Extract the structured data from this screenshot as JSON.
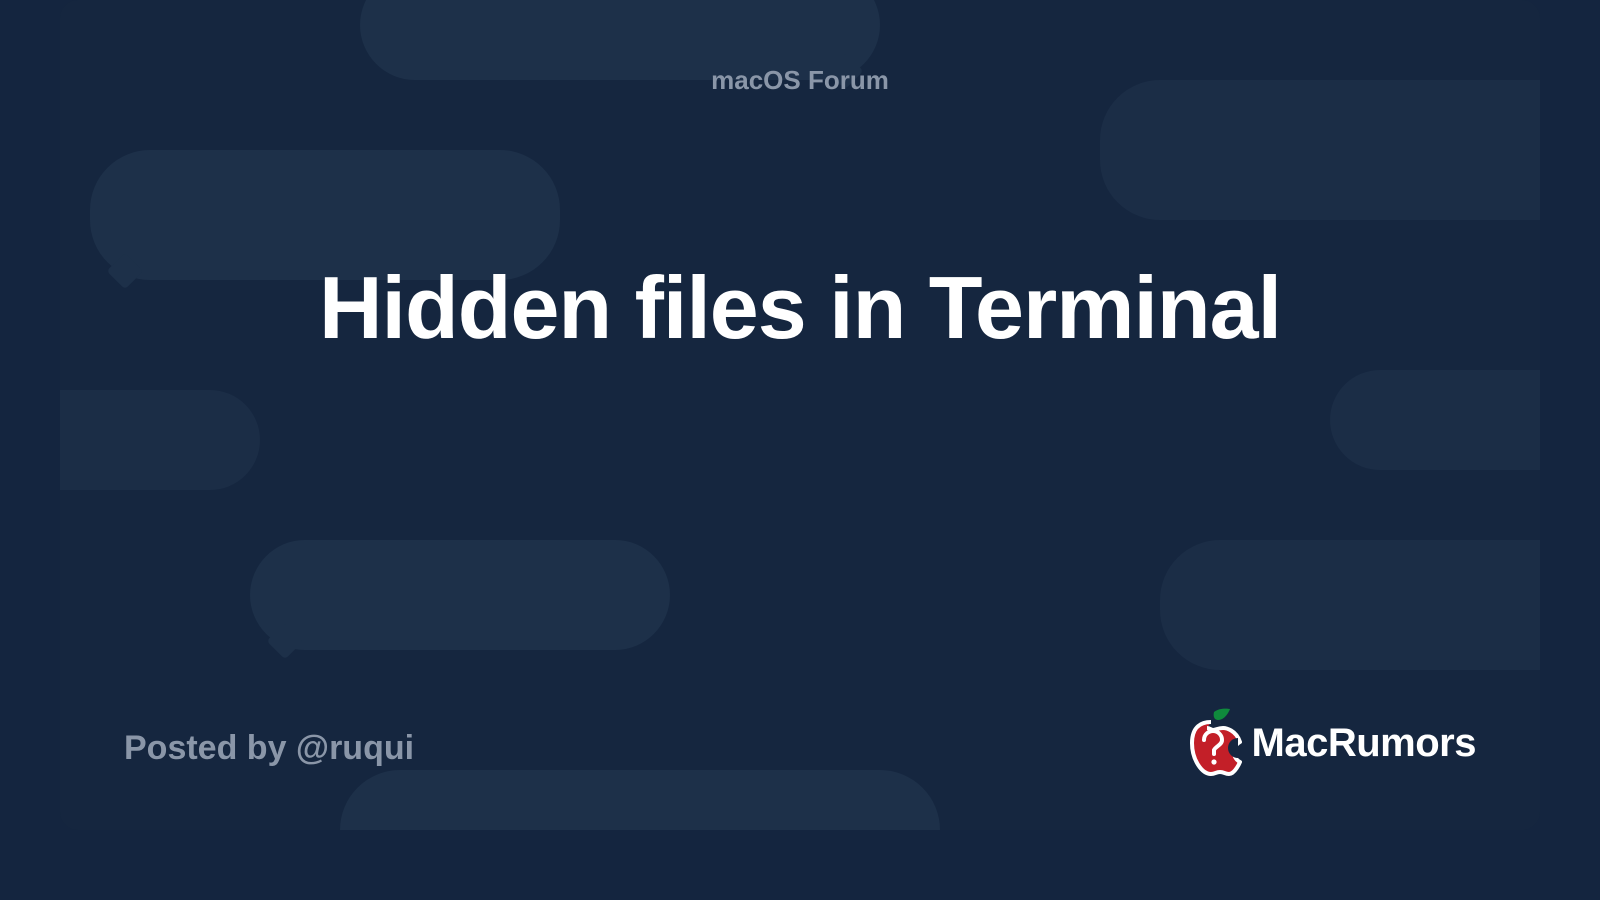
{
  "header": {
    "forum_label": "macOS Forum"
  },
  "main": {
    "title": "Hidden files in Terminal"
  },
  "footer": {
    "posted_by": "Posted by @ruqui",
    "brand_name": "MacRumors"
  }
}
